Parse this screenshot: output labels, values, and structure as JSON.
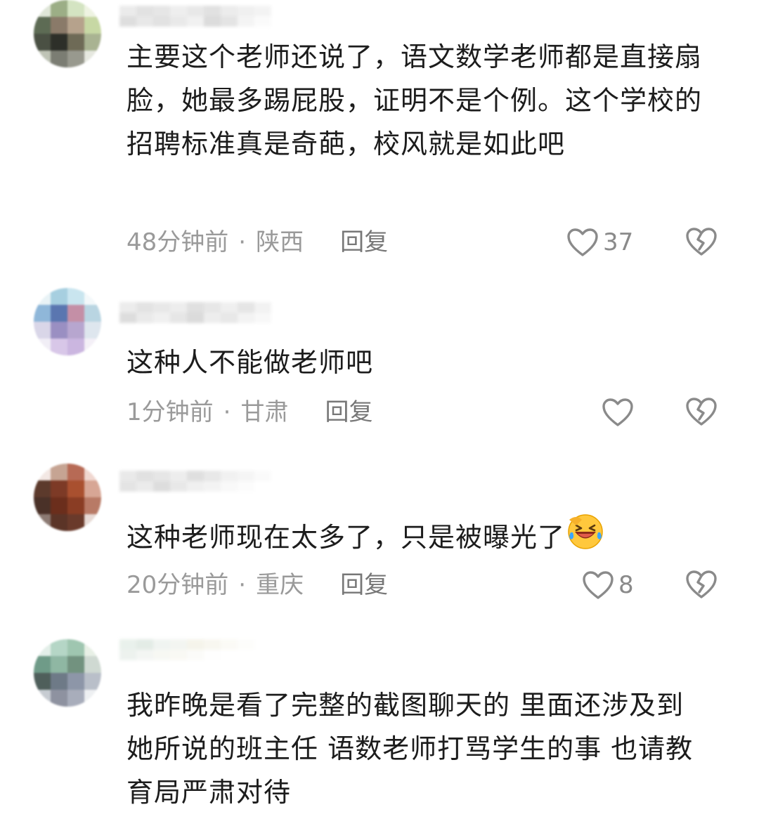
{
  "comments": [
    {
      "text": "主要这个老师还说了，语文数学老师都是直接扇脸，她最多踢屁股，证明不是个例。这个学校的招聘标准真是奇葩，校风就是如此吧",
      "time": "48分钟前",
      "location": "陕西",
      "reply_label": "回复",
      "like_count": "37",
      "avatar_colors": [
        "#dfe6d8",
        "#9cae86",
        "#d4e4c2",
        "#eef3e2",
        "#5d6b54",
        "#8a7a69",
        "#b6a28c",
        "#c7d8a4",
        "#4a5043",
        "#2d2f29",
        "#6e6a56",
        "#a9b392",
        "#bfc4b6",
        "#7b7d73",
        "#98998e",
        "#e6e8e0"
      ],
      "name_colors": [
        "#e8e8e8",
        "#dedede",
        "#e2e2e2",
        "#ececec",
        "#e5e5e5",
        "#dcdcdc",
        "#e9e9e9",
        "#eeeeee",
        "#f2f2f2",
        "#d9d9d9",
        "#e4e4e4",
        "#dddddd",
        "#e6e6e6",
        "#efefef",
        "#d6d6d6",
        "#e0e0e0",
        "#f3f3f3",
        "#fafafa"
      ]
    },
    {
      "text": "这种人不能做老师吧",
      "time": "1分钟前",
      "location": "甘肃",
      "reply_label": "回复",
      "like_count": "",
      "avatar_colors": [
        "#e9f3f6",
        "#a7cfe0",
        "#c9e5ef",
        "#f3f8fa",
        "#8fb7d9",
        "#5a76b0",
        "#c48fa6",
        "#b9d5e2",
        "#d9d6e8",
        "#9a8fc2",
        "#b7a6cf",
        "#dee6ee",
        "#f1eef6",
        "#d8c7e8",
        "#cbb6e0",
        "#f4f0f7"
      ],
      "name_colors": [
        "#e9e9e9",
        "#dfdfdf",
        "#e5e5e5",
        "#eaeaea",
        "#dbdbdb",
        "#e3e3e3",
        "#ededed",
        "#e1e1e1",
        "#f0f0f0",
        "#d8d8d8",
        "#e7e7e7",
        "#eeeeee",
        "#e2e2e2",
        "#d5d5d5",
        "#ebebeb",
        "#e4e4e4",
        "#f1f1f1",
        "#f7f7f7"
      ]
    },
    {
      "text": "这种老师现在太多了，只是被曝光了",
      "time": "20分钟前",
      "location": "重庆",
      "reply_label": "回复",
      "like_count": "8",
      "emoji": "laughing-crying-face",
      "avatar_colors": [
        "#f3e8e4",
        "#c6a493",
        "#b76a55",
        "#f0d7d0",
        "#5c3a2c",
        "#7d3a26",
        "#a9502f",
        "#d7a695",
        "#4a3128",
        "#6b2e1c",
        "#8a3d24",
        "#b87a66",
        "#8c7a73",
        "#5b3427",
        "#6a3a2b",
        "#e7dad5"
      ],
      "name_colors": [
        "#e6e6e6",
        "#dcdcdc",
        "#e2e2e2",
        "#ebebeb",
        "#dadada",
        "#e4e4e4",
        "#efefef",
        "#f4f4f4",
        "#fafafa",
        "#e0e0e0",
        "#e8e8e8",
        "#d8d8d8",
        "#e5e5e5",
        "#eeeeee",
        "#f2f2f2",
        "#f8f8f8",
        "#fcfcfc",
        "#ffffff"
      ]
    },
    {
      "text": "我昨晚是看了完整的截图聊天的 里面还涉及到她所说的班主任 语数老师打骂学生的事 也请教育局严肃对待",
      "time": "",
      "location": "",
      "reply_label": "",
      "like_count": "",
      "avatar_colors": [
        "#e3efe9",
        "#b5d6c6",
        "#9fc6b0",
        "#e8f0e6",
        "#6f9b88",
        "#8fb7a3",
        "#72927f",
        "#cfd9d2",
        "#4f5f5b",
        "#6e7a87",
        "#8d96a8",
        "#b9bfc9",
        "#c7ccd2",
        "#8e92a0",
        "#a8adbb",
        "#eef0f2"
      ],
      "name_colors": [
        "#e6efe9",
        "#dfe9e2",
        "#eef3ef",
        "#f1f4ef",
        "#f4f3e8",
        "#f7f6ee",
        "#fbfaf5",
        "#fdfdfb",
        "#ffffff",
        "#eaf0ec",
        "#f2f5f2",
        "#f6f7f2",
        "#f9f8f3",
        "#fbfbf8",
        "#fefefe",
        "#ffffff",
        "#ffffff",
        "#ffffff"
      ]
    }
  ],
  "icons": {
    "like": "heart-outline-icon",
    "dislike": "broken-heart-icon",
    "emoji": "laughing-crying-face"
  },
  "colors": {
    "text": "#1c1c1c",
    "meta": "#9a9a9a",
    "icon": "#8a8a8a"
  }
}
